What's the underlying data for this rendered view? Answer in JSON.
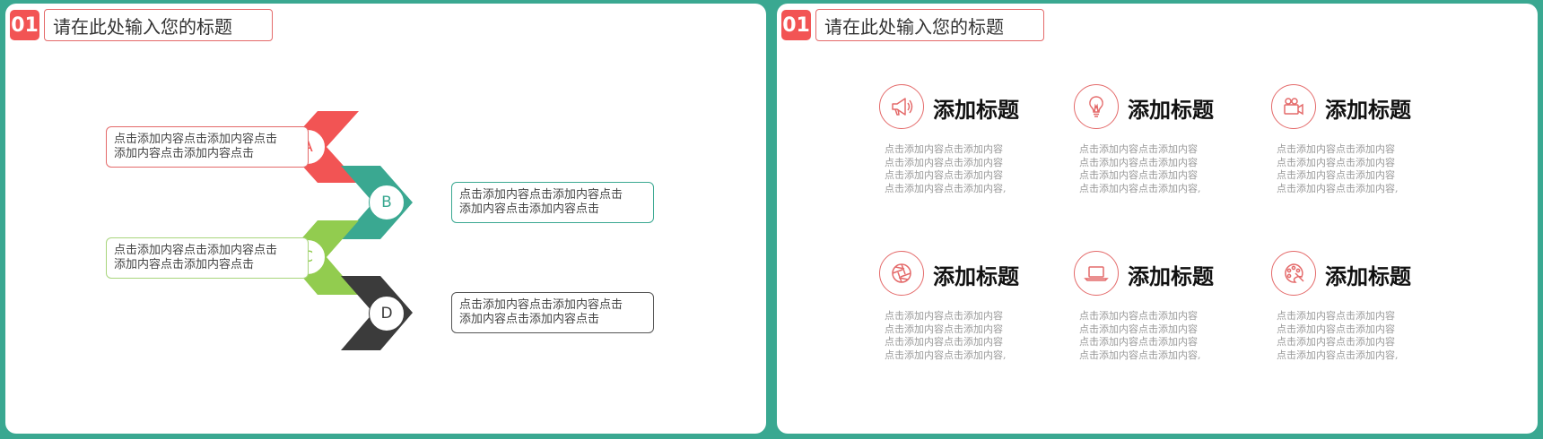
{
  "left_slide": {
    "number": "01",
    "title": "请在此处输入您的标题",
    "steps": [
      {
        "letter": "A",
        "text": [
          "点击添加内容点击添加内容点击",
          "添加内容点击添加内容点击"
        ],
        "color": "#f25454"
      },
      {
        "letter": "B",
        "text": [
          "点击添加内容点击添加内容点击",
          "添加内容点击添加内容点击"
        ],
        "color": "#3aa891"
      },
      {
        "letter": "C",
        "text": [
          "点击添加内容点击添加内容点击",
          "添加内容点击添加内容点击"
        ],
        "color": "#92cc4f"
      },
      {
        "letter": "D",
        "text": [
          "点击添加内容点击添加内容点击",
          "添加内容点击添加内容点击"
        ],
        "color": "#3b3b3b"
      }
    ]
  },
  "right_slide": {
    "number": "01",
    "title": "请在此处输入您的标题",
    "items": [
      {
        "icon": "megaphone-icon",
        "title": "添加标题",
        "desc": [
          "点击添加内容点击添加内容",
          "点击添加内容点击添加内容",
          "点击添加内容点击添加内容",
          "点击添加内容点击添加内容,"
        ]
      },
      {
        "icon": "lightbulb-icon",
        "title": "添加标题",
        "desc": [
          "点击添加内容点击添加内容",
          "点击添加内容点击添加内容",
          "点击添加内容点击添加内容",
          "点击添加内容点击添加内容,"
        ]
      },
      {
        "icon": "video-camera-icon",
        "title": "添加标题",
        "desc": [
          "点击添加内容点击添加内容",
          "点击添加内容点击添加内容",
          "点击添加内容点击添加内容",
          "点击添加内容点击添加内容,"
        ]
      },
      {
        "icon": "aperture-icon",
        "title": "添加标题",
        "desc": [
          "点击添加内容点击添加内容",
          "点击添加内容点击添加内容",
          "点击添加内容点击添加内容",
          "点击添加内容点击添加内容,"
        ]
      },
      {
        "icon": "laptop-icon",
        "title": "添加标题",
        "desc": [
          "点击添加内容点击添加内容",
          "点击添加内容点击添加内容",
          "点击添加内容点击添加内容",
          "点击添加内容点击添加内容,"
        ]
      },
      {
        "icon": "palette-icon",
        "title": "添加标题",
        "desc": [
          "点击添加内容点击添加内容",
          "点击添加内容点击添加内容",
          "点击添加内容点击添加内容",
          "点击添加内容点击添加内容,"
        ]
      }
    ]
  },
  "colors": {
    "frame": "#3aa891",
    "accent_red": "#f25454",
    "teal": "#3aa891",
    "green": "#92cc4f",
    "dark": "#3b3b3b"
  }
}
